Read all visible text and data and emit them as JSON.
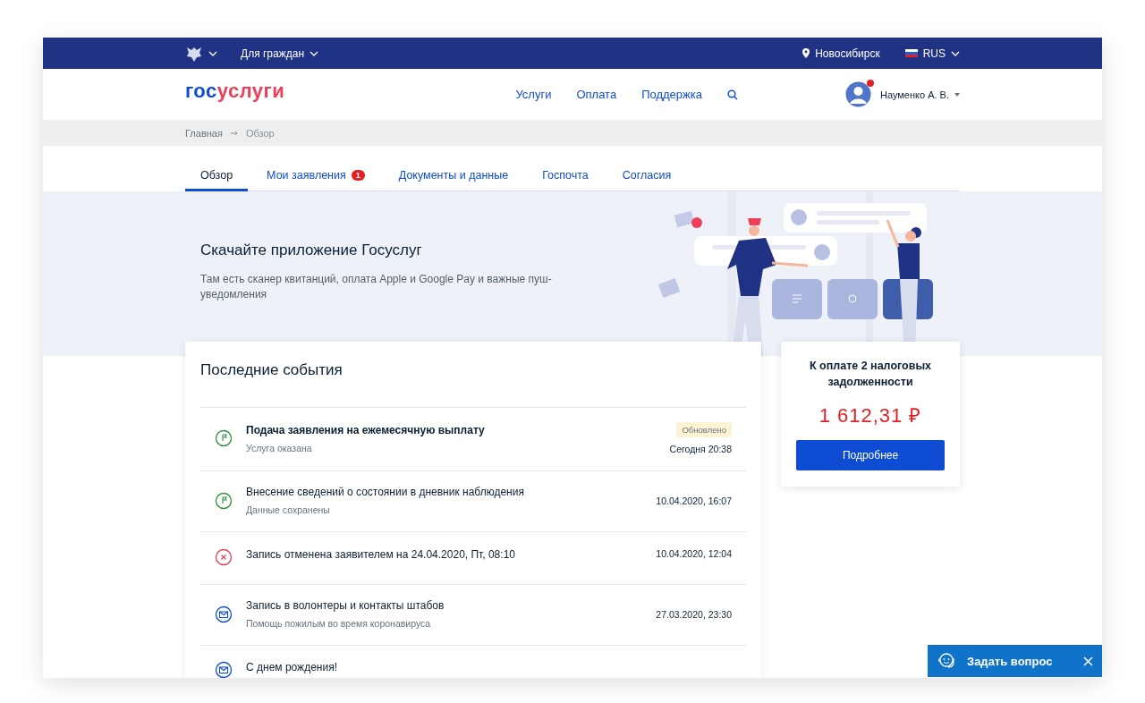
{
  "topbar": {
    "audience": "Для граждан",
    "city": "Новосибирск",
    "language": "RUS"
  },
  "header": {
    "logo": [
      {
        "text": "гос",
        "color": "#0d4cd3"
      },
      {
        "text": "услуги",
        "color": "#ee3f58"
      }
    ],
    "nav": [
      "Услуги",
      "Оплата",
      "Поддержка"
    ],
    "user": {
      "name": "Науменко А. В.",
      "notification": true
    }
  },
  "breadcrumbs": [
    "Главная",
    "Обзор"
  ],
  "tabs": [
    {
      "label": "Обзор",
      "selected": true
    },
    {
      "label": "Мои заявления",
      "selected": false,
      "badge": "1"
    },
    {
      "label": "Документы и данные",
      "selected": false
    },
    {
      "label": "Госпочта",
      "selected": false
    },
    {
      "label": "Согласия",
      "selected": false
    }
  ],
  "banner": {
    "title": "Скачайте приложение Госуслуг",
    "text": "Там есть сканер квитанций, оплата Apple и Google Pay и важные пуш-уведомления"
  },
  "events": {
    "title": "Последние события",
    "items": [
      {
        "kind": "done",
        "title": "Подача заявления на ежемесячную выплату",
        "subtitle": "Услуга оказана",
        "badge": "Обновлено",
        "time": "Сегодня 20:38",
        "unread": true
      },
      {
        "kind": "done",
        "title": "Внесение сведений о состоянии в дневник наблюдения",
        "subtitle": "Данные сохранены",
        "time": "10.04.2020, 16:07",
        "unread": false
      },
      {
        "kind": "cancelled",
        "title": "Запись отменена заявителем на 24.04.2020, Пт, 08:10",
        "time": "10.04.2020, 12:04",
        "unread": false
      },
      {
        "kind": "message",
        "title": "Запись в волонтеры и контакты штабов",
        "subtitle": "Помощь пожилым во время коронавируса",
        "time": "27.03.2020, 23:30",
        "unread": false
      },
      {
        "kind": "message",
        "title": "С днем рождения!",
        "unread": false
      }
    ]
  },
  "payment": {
    "title": "К оплате 2 налоговых задолженности",
    "amount": "1 612,31 ₽",
    "button": "Подробнее"
  },
  "chat": {
    "label": "Задать вопрос"
  }
}
